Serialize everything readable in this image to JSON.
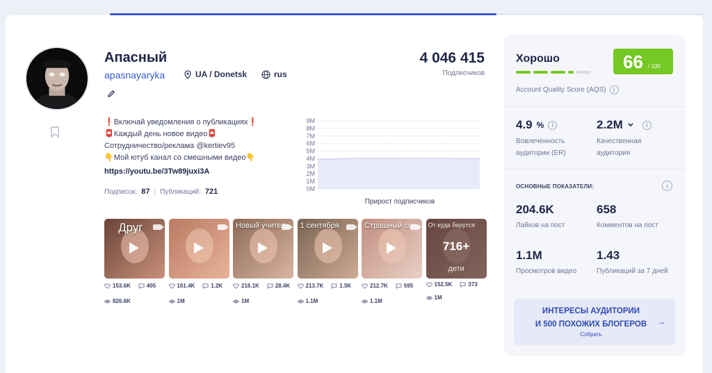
{
  "profile": {
    "name": "Апасный",
    "handle": "apasnayaryka",
    "location": "UA / Donetsk",
    "language": "rus",
    "subscribers": "4 046 415",
    "subscribers_label": "Подписчиков",
    "bio": [
      "❗Включай уведомления о публикациях❗",
      "📮Каждый день новое видео📮",
      "Сотрудничество/реклама @kertiev95",
      "👇Мой ютуб канал со смешными видео👇"
    ],
    "link": "https://youtu.be/3Tw89juxi3A",
    "following_label": "Подписок:",
    "following": "87",
    "posts_label": "Публикаций:",
    "posts": "721"
  },
  "chart_data": {
    "type": "area",
    "title": "",
    "xlabel": "Прирост подписчиков",
    "ylabel": "",
    "y_ticks": [
      "0M",
      "1M",
      "2M",
      "3M",
      "4M",
      "5M",
      "6M",
      "7M",
      "8M",
      "9M"
    ],
    "ylim": [
      0,
      9000000
    ],
    "values": [
      3900000,
      3950000,
      4000000,
      4050000,
      4050000,
      4046415,
      4040000,
      4030000,
      4030000,
      4020000,
      4010000,
      4000000
    ],
    "grid": true,
    "colors": {
      "fill": "#e8ebf7",
      "line": "#c9cfea"
    }
  },
  "videos": [
    {
      "caption": "Друг",
      "likes": "153.6K",
      "comments": "405",
      "views": "826.6K",
      "colors": [
        "#6b4438",
        "#c9907a"
      ]
    },
    {
      "caption": "",
      "likes": "161.4K",
      "comments": "1.2K",
      "views": "1M",
      "colors": [
        "#b97a62",
        "#e8b39a"
      ]
    },
    {
      "caption": "Новый учитель",
      "likes": "216.1K",
      "comments": "28.4K",
      "views": "1M",
      "colors": [
        "#8d6a57",
        "#d9b5a0"
      ]
    },
    {
      "caption": "1 сентября",
      "likes": "213.7K",
      "comments": "1.5K",
      "views": "1.1M",
      "colors": [
        "#7b6553",
        "#cda994"
      ]
    },
    {
      "caption": "Страшный сон",
      "likes": "212.7K",
      "comments": "595",
      "views": "1.1M",
      "colors": [
        "#c08e80",
        "#ead0c5"
      ]
    },
    {
      "caption": "От куда берутся",
      "more": "716+",
      "more_sub": "дети",
      "likes": "152.5K",
      "comments": "373",
      "views": "1M",
      "colors": [
        "#9a6a5c",
        "#d7ab9e"
      ]
    }
  ],
  "aqs": {
    "title": "Хорошо",
    "score": "66",
    "of": "/ 100",
    "label": "Account Quality Score (AQS)",
    "accent": "#76c824"
  },
  "er": {
    "value": "4.9",
    "unit": "%",
    "label1": "Вовлеченность",
    "label2": "аудитории (ER)"
  },
  "quality": {
    "value": "2.2M",
    "label1": "Качественная",
    "label2": "аудитория"
  },
  "main_stats": {
    "label": "ОСНОВНЫЕ ПОКАЗАТЕЛИ:",
    "likes": "204.6K",
    "likes_label": "Лайков на пост",
    "comments": "658",
    "comments_label": "Комментов на пост",
    "views": "1.1M",
    "views_label": "Просмотров видео",
    "posts7": "1.43",
    "posts7_label": "Публикаций за 7 дней"
  },
  "cta": {
    "line1": "ИНТЕРЕСЫ АУДИТОРИИ",
    "line2": "И 500 ПОХОЖИХ БЛОГЕРОВ",
    "sub": "Собрать"
  }
}
